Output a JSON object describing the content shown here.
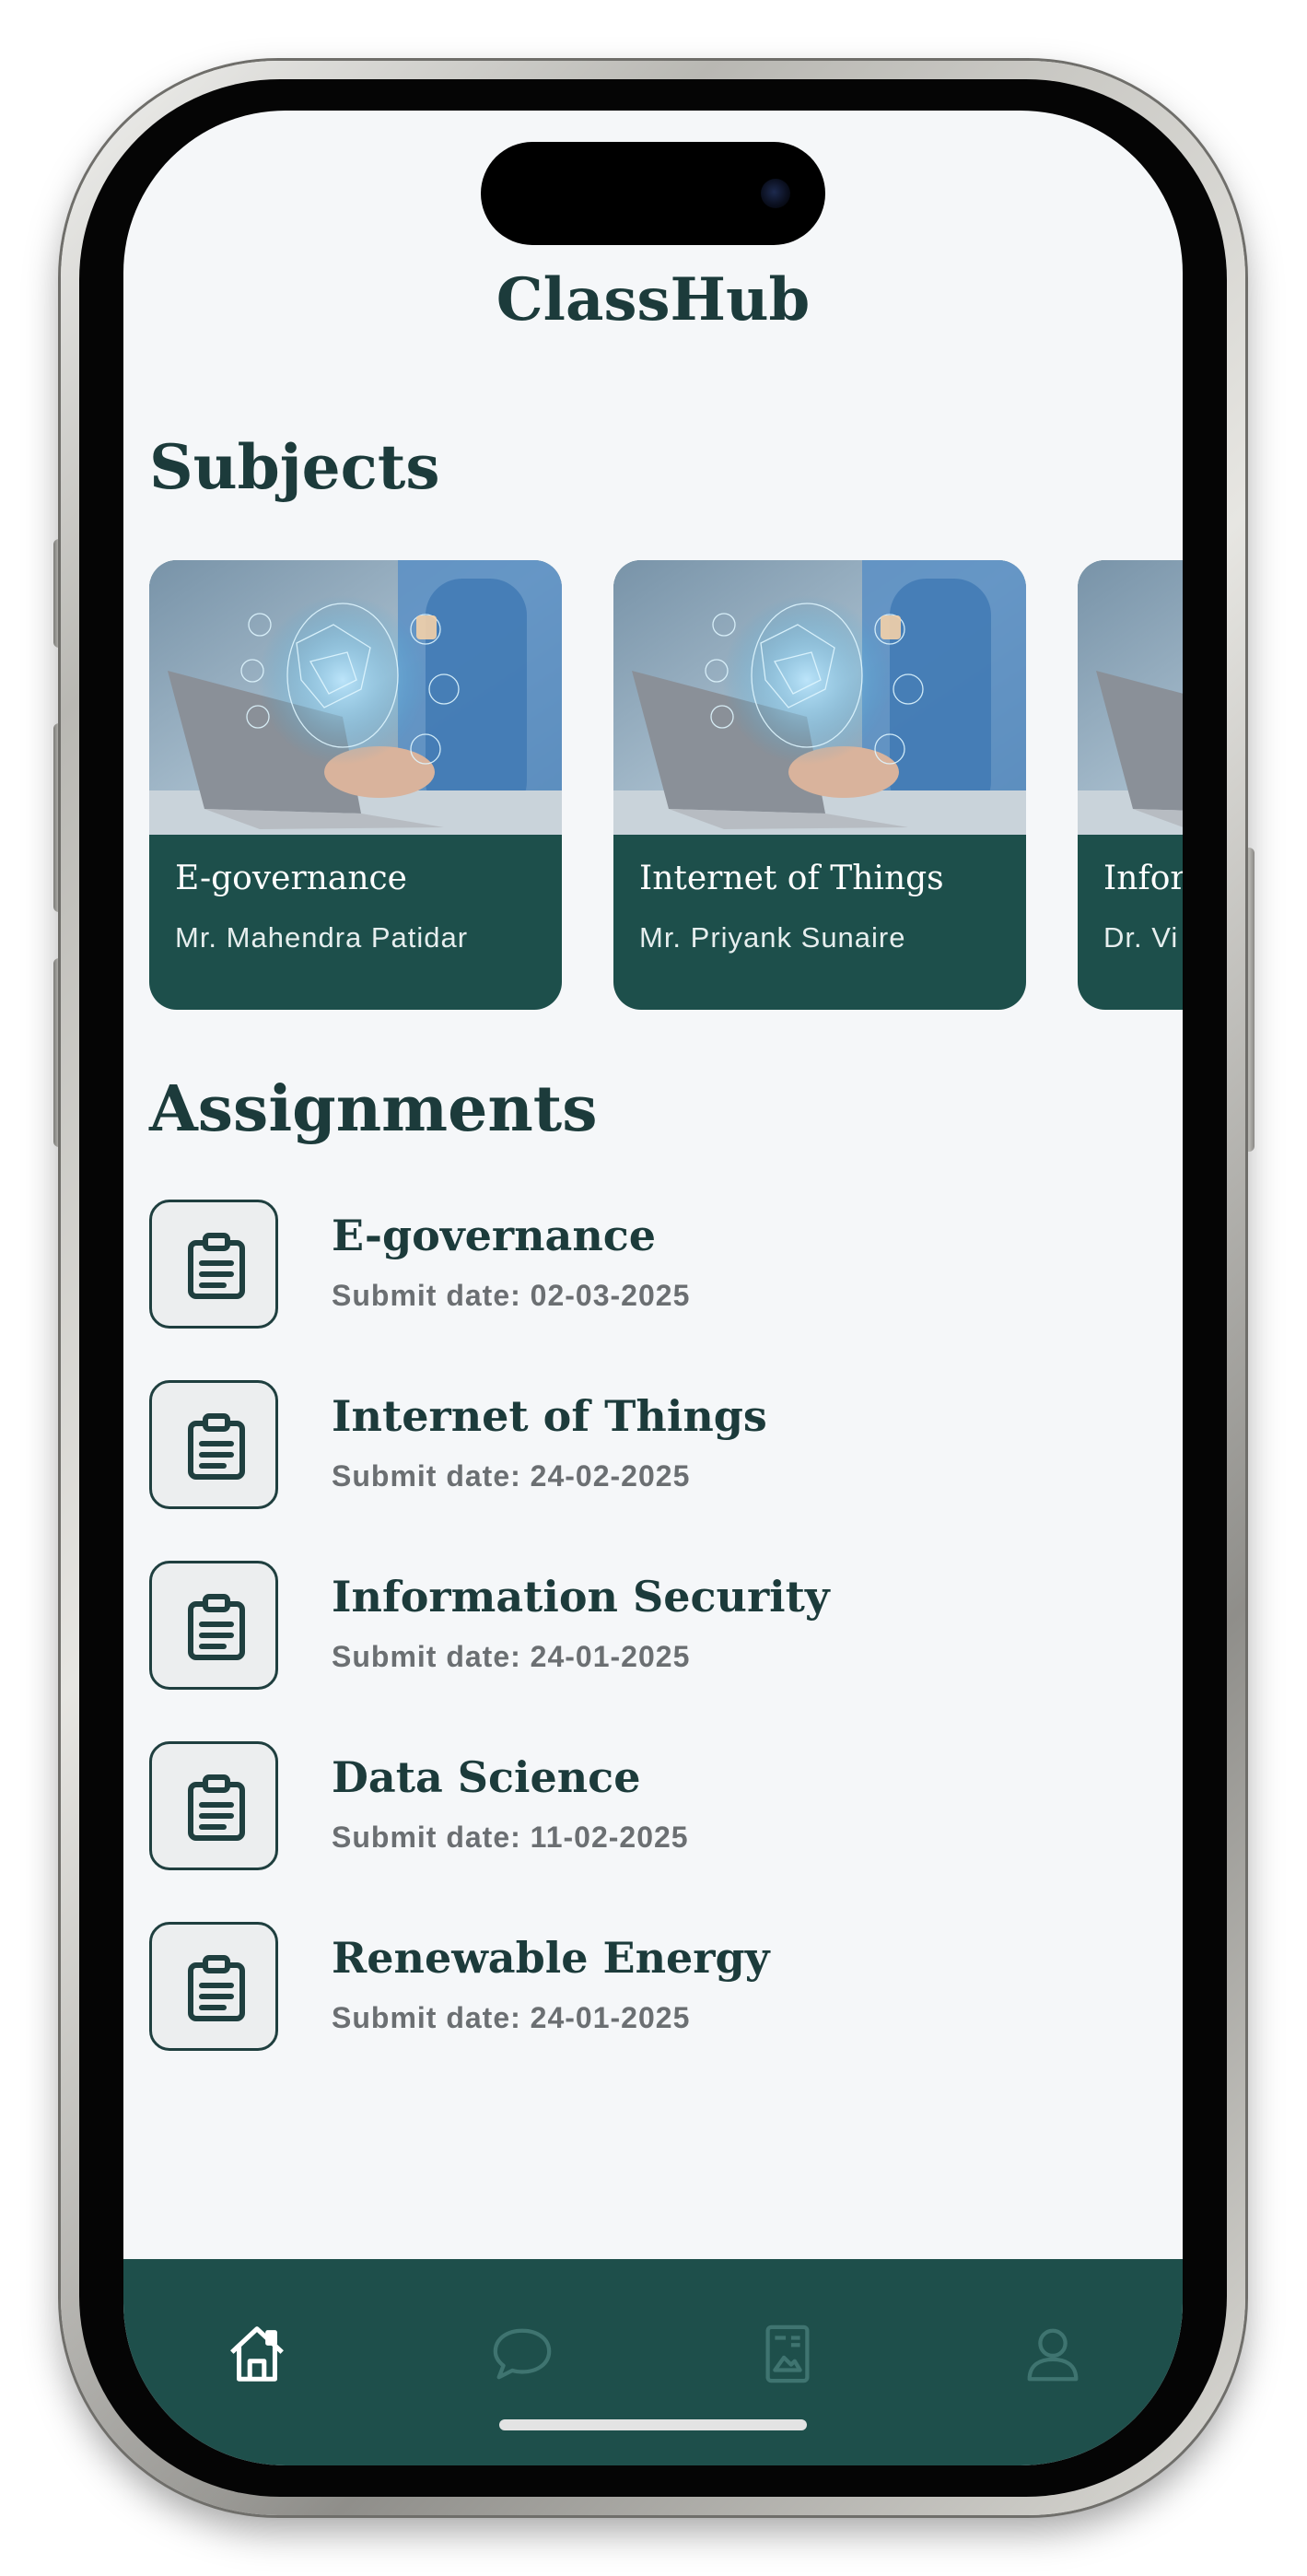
{
  "app": {
    "title": "ClassHub"
  },
  "colors": {
    "accent": "#1e4f4b",
    "title": "#1c3b3b",
    "background": "#f5f7f9"
  },
  "subjects": {
    "heading": "Subjects",
    "cards": [
      {
        "name": "E-governance",
        "teacher": "Mr. Mahendra Patidar"
      },
      {
        "name": "Internet of Things",
        "teacher": "Mr. Priyank Sunaire"
      },
      {
        "name": "Infor",
        "teacher": "Dr. Vi"
      }
    ]
  },
  "assignments": {
    "heading": "Assignments",
    "items": [
      {
        "name": "E-governance",
        "date": "Submit date: 02-03-2025"
      },
      {
        "name": "Internet of Things",
        "date": "Submit date: 24-02-2025"
      },
      {
        "name": "Information Security",
        "date": "Submit date: 24-01-2025"
      },
      {
        "name": "Data Science",
        "date": "Submit date: 11-02-2025"
      },
      {
        "name": "Renewable Energy",
        "date": "Submit date: 24-01-2025"
      }
    ]
  },
  "nav": {
    "items": [
      {
        "icon": "home-icon",
        "active": true
      },
      {
        "icon": "chat-bubble-icon",
        "active": false
      },
      {
        "icon": "document-icon",
        "active": false
      },
      {
        "icon": "profile-icon",
        "active": false
      }
    ]
  }
}
